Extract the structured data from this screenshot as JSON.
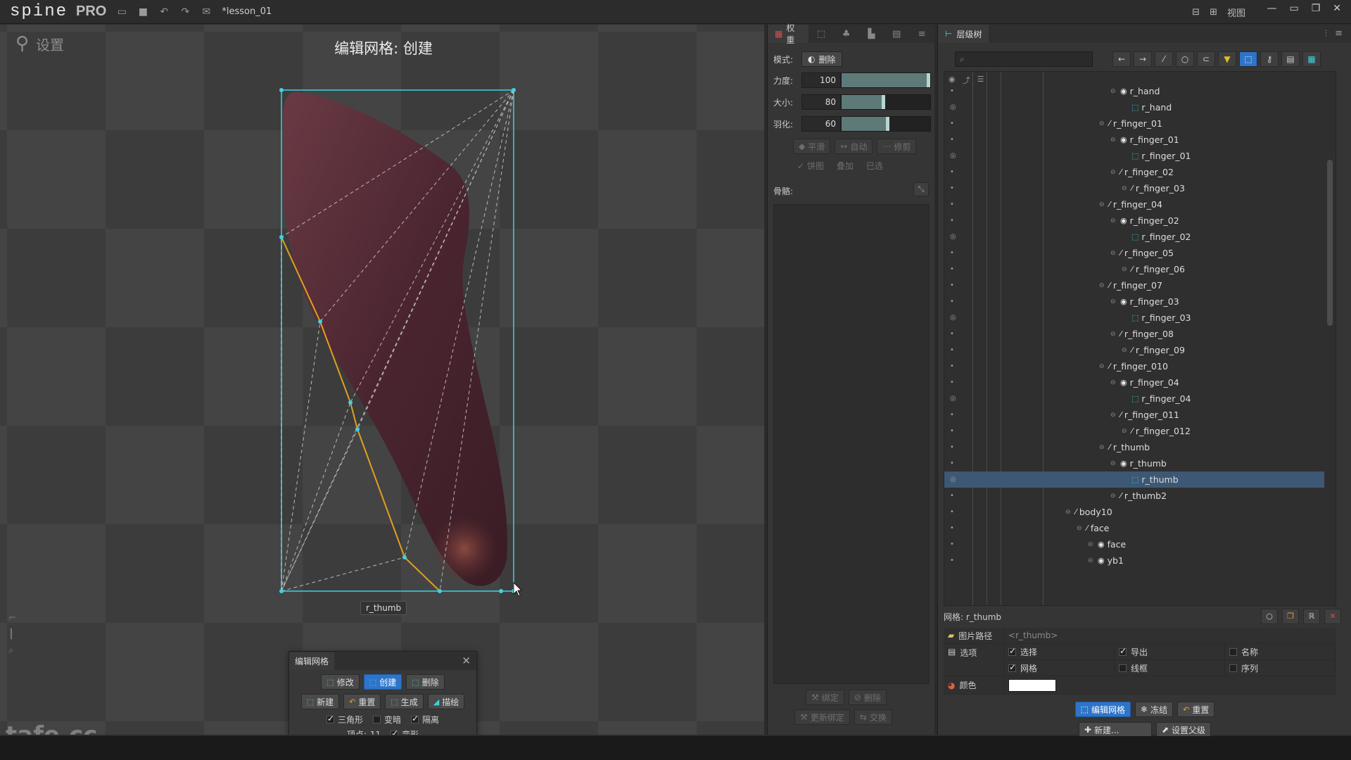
{
  "app": {
    "logo": "spine",
    "edition": "PRO",
    "document": "*lesson_01",
    "view_menu": "视图"
  },
  "viewport": {
    "mode_label": "设置",
    "title": "编辑网格: 创建",
    "slot_label": "r_thumb",
    "watermark": "tafe.cc"
  },
  "mesh_dialog": {
    "title": "编辑网格",
    "buttons_row1": [
      "修改",
      "创建",
      "删除"
    ],
    "active_button": "创建",
    "buttons_row2": [
      "新建",
      "重置",
      "生成",
      "描绘"
    ],
    "checks": {
      "triangles": {
        "label": "三角形",
        "checked": true
      },
      "dim": {
        "label": "变暗",
        "checked": false
      },
      "isolate": {
        "label": "隔离",
        "checked": true
      },
      "deform": {
        "label": "变形",
        "checked": true
      }
    },
    "vertex_label": "顶点:",
    "vertex_count": "11"
  },
  "weights": {
    "tab_label": "权重",
    "mode_label": "模式:",
    "mode_value": "删除",
    "sliders": [
      {
        "label": "力度:",
        "value": "100",
        "fraction": 1.0
      },
      {
        "label": "大小:",
        "value": "80",
        "fraction": 0.45
      },
      {
        "label": "羽化:",
        "value": "60",
        "fraction": 0.5
      }
    ],
    "tool_buttons": [
      "平滑",
      "自动",
      "修剪"
    ],
    "toggles": [
      "饼图",
      "叠加",
      "已选"
    ],
    "bones_label": "骨骼:",
    "bottom_buttons_row1": [
      "绑定",
      "删除"
    ],
    "bottom_buttons_row2": [
      "更新绑定",
      "交换"
    ]
  },
  "tree": {
    "tab_label": "层级树",
    "search_placeholder": "",
    "rows": [
      {
        "label": "r_hand",
        "type": "slot",
        "depth": 2,
        "eye": "dot"
      },
      {
        "label": "r_hand",
        "type": "mesh",
        "depth": 3,
        "eye": "eye"
      },
      {
        "label": "r_finger_01",
        "type": "bone",
        "depth": 1,
        "eye": "dot"
      },
      {
        "label": "r_finger_01",
        "type": "slot",
        "depth": 2,
        "eye": "dot"
      },
      {
        "label": "r_finger_01",
        "type": "mesh",
        "depth": 3,
        "eye": "eye"
      },
      {
        "label": "r_finger_02",
        "type": "bone",
        "depth": 2,
        "eye": "dot"
      },
      {
        "label": "r_finger_03",
        "type": "bone",
        "depth": 3,
        "eye": "dot"
      },
      {
        "label": "r_finger_04",
        "type": "bone",
        "depth": 1,
        "eye": "dot"
      },
      {
        "label": "r_finger_02",
        "type": "slot",
        "depth": 2,
        "eye": "dot"
      },
      {
        "label": "r_finger_02",
        "type": "mesh",
        "depth": 3,
        "eye": "eye"
      },
      {
        "label": "r_finger_05",
        "type": "bone",
        "depth": 2,
        "eye": "dot"
      },
      {
        "label": "r_finger_06",
        "type": "bone",
        "depth": 3,
        "eye": "dot"
      },
      {
        "label": "r_finger_07",
        "type": "bone",
        "depth": 1,
        "eye": "dot"
      },
      {
        "label": "r_finger_03",
        "type": "slot",
        "depth": 2,
        "eye": "dot"
      },
      {
        "label": "r_finger_03",
        "type": "mesh",
        "depth": 3,
        "eye": "eye"
      },
      {
        "label": "r_finger_08",
        "type": "bone",
        "depth": 2,
        "eye": "dot"
      },
      {
        "label": "r_finger_09",
        "type": "bone",
        "depth": 3,
        "eye": "dot"
      },
      {
        "label": "r_finger_010",
        "type": "bone",
        "depth": 1,
        "eye": "dot"
      },
      {
        "label": "r_finger_04",
        "type": "slot",
        "depth": 2,
        "eye": "dot"
      },
      {
        "label": "r_finger_04",
        "type": "mesh",
        "depth": 3,
        "eye": "eye"
      },
      {
        "label": "r_finger_011",
        "type": "bone",
        "depth": 2,
        "eye": "dot"
      },
      {
        "label": "r_finger_012",
        "type": "bone",
        "depth": 3,
        "eye": "dot"
      },
      {
        "label": "r_thumb",
        "type": "bone",
        "depth": 1,
        "eye": "dot"
      },
      {
        "label": "r_thumb",
        "type": "slot",
        "depth": 2,
        "eye": "dot"
      },
      {
        "label": "r_thumb",
        "type": "mesh",
        "depth": 3,
        "eye": "eye",
        "selected": true
      },
      {
        "label": "r_thumb2",
        "type": "bone",
        "depth": 2,
        "eye": "dot"
      },
      {
        "label": "body10",
        "type": "bone",
        "depth": -2,
        "eye": "dot"
      },
      {
        "label": "face",
        "type": "bone",
        "depth": -1,
        "eye": "dot"
      },
      {
        "label": "face",
        "type": "slot",
        "depth": 0,
        "eye": "dot"
      },
      {
        "label": "yb1",
        "type": "slot",
        "depth": 0,
        "eye": "dot"
      }
    ]
  },
  "properties": {
    "title": "网格: r_thumb",
    "image_path_label": "图片路径",
    "image_path_value": "<r_thumb>",
    "options_label": "选项",
    "options": [
      {
        "label": "选择",
        "checked": true
      },
      {
        "label": "导出",
        "checked": true
      },
      {
        "label": "名称",
        "checked": false
      },
      {
        "label": "网格",
        "checked": true
      },
      {
        "label": "线框",
        "checked": false
      },
      {
        "label": "序列",
        "checked": false
      }
    ],
    "color_label": "颜色",
    "color_value": "#ffffff",
    "buttons_row1": [
      "编辑网格",
      "冻结",
      "重置"
    ],
    "buttons_row2": [
      "新建...",
      "设置父级"
    ]
  },
  "colors": {
    "accent_blue": "#2e74c9",
    "mesh_cyan": "#3fd2e0",
    "hull_orange": "#e0a020",
    "selection_row": "#3d5874"
  }
}
